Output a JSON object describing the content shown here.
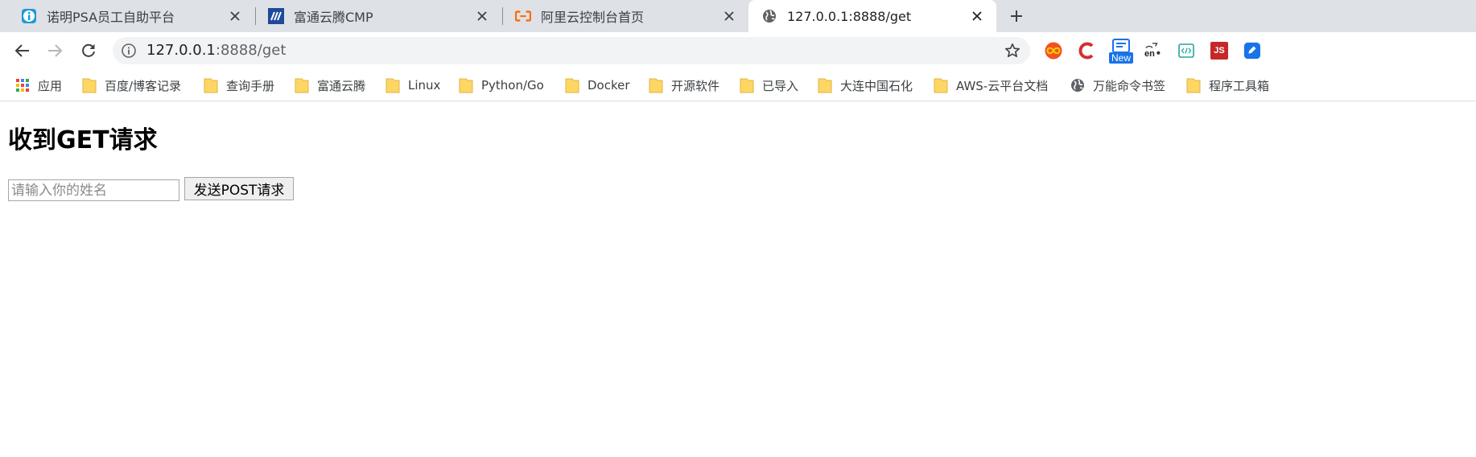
{
  "tabs": [
    {
      "title": "诺明PSA员工自助平台",
      "favicon": "info-icon"
    },
    {
      "title": "富通云腾CMP",
      "favicon": "cmp-logo-icon"
    },
    {
      "title": "阿里云控制台首页",
      "favicon": "aliyun-icon"
    },
    {
      "title": "127.0.0.1:8888/get",
      "favicon": "globe-icon",
      "active": true
    }
  ],
  "omnibox": {
    "host": "127.0.0.1",
    "path": ":8888/get"
  },
  "extensions": [
    {
      "name": "infinity-extension-icon"
    },
    {
      "name": "c-extension-icon"
    },
    {
      "name": "new-badge-extension-icon",
      "badge": "New"
    },
    {
      "name": "translate-extension-icon",
      "text": "en"
    },
    {
      "name": "code-extension-icon"
    },
    {
      "name": "js-extension-icon",
      "text": "JS"
    },
    {
      "name": "blue-pen-extension-icon"
    }
  ],
  "bookmarks": [
    {
      "label": "应用",
      "icon": "apps-grid-icon"
    },
    {
      "label": "百度/博客记录",
      "icon": "folder-icon"
    },
    {
      "label": "查询手册",
      "icon": "folder-icon"
    },
    {
      "label": "富通云腾",
      "icon": "folder-icon"
    },
    {
      "label": "Linux",
      "icon": "folder-icon"
    },
    {
      "label": "Python/Go",
      "icon": "folder-icon"
    },
    {
      "label": "Docker",
      "icon": "folder-icon"
    },
    {
      "label": "开源软件",
      "icon": "folder-icon"
    },
    {
      "label": "已导入",
      "icon": "folder-icon"
    },
    {
      "label": "大连中国石化",
      "icon": "folder-icon"
    },
    {
      "label": "AWS-云平台文档",
      "icon": "folder-icon"
    },
    {
      "label": "万能命令书签",
      "icon": "globe-icon"
    },
    {
      "label": "程序工具箱",
      "icon": "folder-icon"
    }
  ],
  "page": {
    "heading": "收到GET请求",
    "input_placeholder": "请输入你的姓名",
    "button_label": "发送POST请求"
  },
  "colors": {
    "folder": "#fdd663",
    "folder_edge": "#e3b341",
    "aliyun": "#ff6a00",
    "cmp": "#1e4a9a",
    "info": "#1a9bd7"
  }
}
